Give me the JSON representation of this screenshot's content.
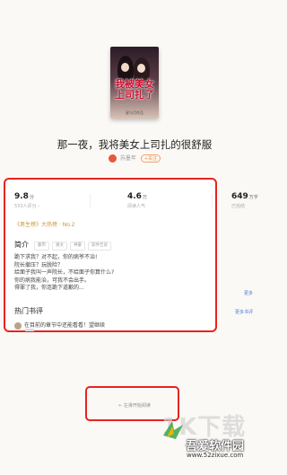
{
  "book": {
    "cover_title": "我被美女上司扎了",
    "cover_footer": "星与月作品",
    "title": "那一夜，我将美女上司扎的很舒服",
    "author": "苏墨年",
    "author_tag": "+关注"
  },
  "stats": [
    {
      "num": "9.8",
      "unit": "分",
      "label": "533人评分 ›"
    },
    {
      "num": "4.6",
      "unit": "万",
      "label": "阅读人气"
    },
    {
      "num": "649",
      "unit": "万字",
      "label": "已完结"
    }
  ],
  "rank": "《男生榜》大热榜 · No.2",
  "intro": {
    "heading": "简介",
    "tags": [
      "都市",
      "爽文",
      "神豪",
      "软件告诉"
    ],
    "lines": [
      "跪下求我？对不起，你的病爷不治!",
      "院长撤压？玩脱险？",
      "给面子我叫一声院长，不给面子你算什么?",
      "你的病我能治，可我不会出手。",
      "得罪了我，你连跪下道歉的..."
    ],
    "more": "更多"
  },
  "comments": {
    "heading": "热门书评",
    "more": "更多书评",
    "first": "在目前的章节中还能看看！望继续"
  },
  "start_reading": "← 左滑开始阅读",
  "watermark": {
    "big": "1K下载",
    "name": "吾爱软件园",
    "url": "www.52zixue.com"
  },
  "colors": {
    "highlight": "#e8231e",
    "rank": "#c99a3b",
    "link": "#4a7bd8"
  }
}
